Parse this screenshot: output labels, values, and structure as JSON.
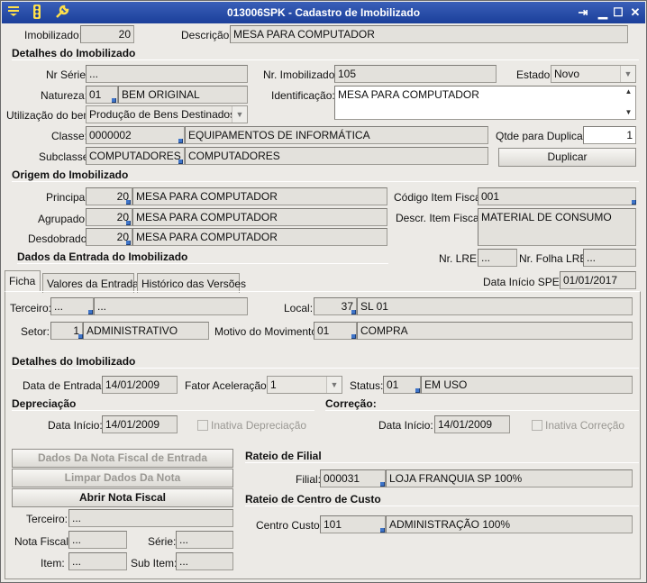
{
  "window": {
    "title": "013006SPK - Cadastro de Imobilizado",
    "icons": [
      "menu-icon",
      "traffic-light-icon",
      "wrench-icon"
    ],
    "controls": [
      "restore-icon",
      "minimize-icon",
      "maximize-icon",
      "close-icon"
    ]
  },
  "header": {
    "imobilizado_label": "Imobilizado:",
    "imobilizado_value": "20",
    "descricao_label": "Descrição:",
    "descricao_value": "MESA PARA COMPUTADOR"
  },
  "detalhes": {
    "title": "Detalhes do Imobilizado",
    "nr_serie_label": "Nr Série:",
    "nr_serie_value": "...",
    "nr_imobilizado_label": "Nr. Imobilizado:",
    "nr_imobilizado_value": "105",
    "estado_label": "Estado:",
    "estado_value": "Novo",
    "natureza_label": "Natureza:",
    "natureza_code": "01",
    "natureza_desc": "BEM ORIGINAL",
    "identificacao_label": "Identificação:",
    "identificacao_value": "MESA PARA COMPUTADOR",
    "utilizacao_label": "Utilização do bem:",
    "utilizacao_value": "Produção de Bens Destinados a V",
    "classe_label": "Classe:",
    "classe_code": "0000002",
    "classe_desc": "EQUIPAMENTOS DE INFORMÁTICA",
    "subclasse_label": "Subclasse:",
    "subclasse_code": "COMPUTADORES",
    "subclasse_desc": "COMPUTADORES",
    "qtde_label": "Qtde para Duplicar:",
    "qtde_value": "1",
    "duplicar_button": "Duplicar"
  },
  "origem": {
    "title": "Origem do Imobilizado",
    "principal_label": "Principal:",
    "principal_code": "20",
    "principal_desc": "MESA PARA COMPUTADOR",
    "agrupado_label": "Agrupado:",
    "agrupado_code": "20",
    "agrupado_desc": "MESA PARA COMPUTADOR",
    "desdobrado_label": "Desdobrado:",
    "desdobrado_code": "20",
    "desdobrado_desc": "MESA PARA COMPUTADOR",
    "codigo_item_label": "Código Item Fiscal:",
    "codigo_item_value": "001",
    "descr_item_label": "Descr. Item Fiscal:",
    "descr_item_value": "MATERIAL DE CONSUMO"
  },
  "entrada": {
    "title": "Dados da Entrada do Imobilizado",
    "nr_lre_label": "Nr. LRE:",
    "nr_lre_value": "...",
    "nr_folha_label": "Nr. Folha LRE:",
    "nr_folha_value": "...",
    "data_sped_label": "Data Início SPED:",
    "data_sped_value": "01/01/2017"
  },
  "tabs": [
    {
      "label": "Ficha",
      "active": true
    },
    {
      "label": "Valores da Entrada",
      "active": false
    },
    {
      "label": "Histórico das Versões",
      "active": false
    }
  ],
  "ficha": {
    "terceiro_label": "Terceiro:",
    "terceiro_code": "...",
    "terceiro_desc": "...",
    "local_label": "Local:",
    "local_code": "37",
    "local_desc": "SL 01",
    "setor_label": "Setor:",
    "setor_code": "1",
    "setor_desc": "ADMINISTRATIVO",
    "motivo_label": "Motivo do Movimento:",
    "motivo_code": "01",
    "motivo_desc": "COMPRA",
    "detalhes_title": "Detalhes do Imobilizado",
    "data_entrada_label": "Data de Entrada:",
    "data_entrada_value": "14/01/2009",
    "fator_label": "Fator Aceleração:",
    "fator_value": "1",
    "status_label": "Status:",
    "status_code": "01",
    "status_desc": "EM USO",
    "depreciacao_title": "Depreciação",
    "dep_data_label": "Data Início:",
    "dep_data_value": "14/01/2009",
    "dep_inativa_label": "Inativa Depreciação",
    "correcao_title": "Correção:",
    "cor_data_label": "Data Início:",
    "cor_data_value": "14/01/2009",
    "cor_inativa_label": "Inativa Correção",
    "btn_dados_nota": "Dados Da Nota Fiscal de Entrada",
    "btn_limpar": "Limpar Dados Da Nota",
    "btn_abrir": "Abrir Nota Fiscal",
    "nf_terceiro_label": "Terceiro:",
    "nf_terceiro_value": "...",
    "nf_nota_label": "Nota Fiscal:",
    "nf_nota_value": "...",
    "nf_serie_label": "Série:",
    "nf_serie_value": "...",
    "nf_item_label": "Item:",
    "nf_item_value": "...",
    "nf_subitem_label": "Sub Item:",
    "nf_subitem_value": "...",
    "rateio_filial_title": "Rateio de Filial",
    "filial_label": "Filial:",
    "filial_code": "000031",
    "filial_desc": "LOJA FRANQUIA SP 100%",
    "rateio_cc_title": "Rateio de Centro de Custo",
    "cc_label": "Centro Custo:",
    "cc_code": "101",
    "cc_desc": "ADMINISTRAÇÃO 100%"
  }
}
